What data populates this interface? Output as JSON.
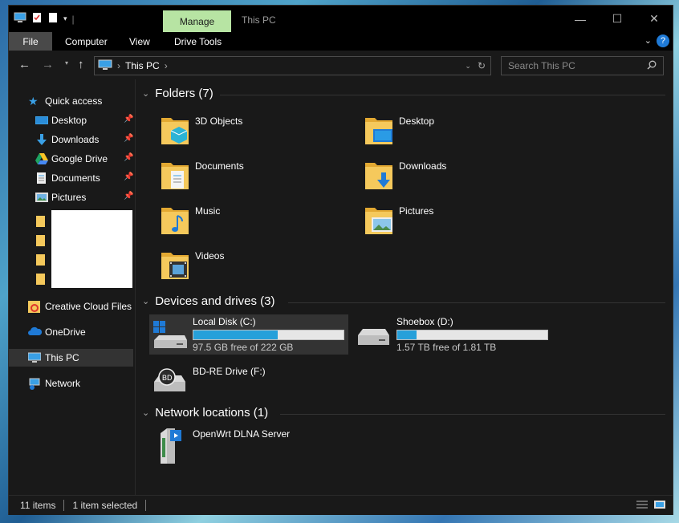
{
  "titlebar": {
    "manage_tab": "Manage",
    "window_title": "This PC",
    "minimize": "—",
    "maximize": "☐",
    "close": "✕"
  },
  "ribbon": {
    "tabs": [
      "File",
      "Computer",
      "View",
      "Drive Tools"
    ],
    "help": "?"
  },
  "address": {
    "path": [
      "This PC"
    ],
    "search_placeholder": "Search This PC"
  },
  "nav": {
    "quick_access": "Quick access",
    "items": [
      {
        "label": "Desktop",
        "pinned": true
      },
      {
        "label": "Downloads",
        "pinned": true
      },
      {
        "label": "Google Drive",
        "pinned": true
      },
      {
        "label": "Documents",
        "pinned": true
      },
      {
        "label": "Pictures",
        "pinned": true
      }
    ],
    "creative_cloud": "Creative Cloud Files",
    "onedrive": "OneDrive",
    "this_pc": "This PC",
    "network": "Network"
  },
  "content": {
    "folders_header": "Folders (7)",
    "folders": [
      "3D Objects",
      "Desktop",
      "Documents",
      "Downloads",
      "Music",
      "Pictures",
      "Videos"
    ],
    "devices_header": "Devices and drives (3)",
    "drives": [
      {
        "name": "Local Disk (C:)",
        "free": "97.5 GB free of 222 GB",
        "used_fraction": 0.56
      },
      {
        "name": "Shoebox (D:)",
        "free": "1.57 TB free of 1.81 TB",
        "used_fraction": 0.13
      },
      {
        "name": "BD-RE Drive (F:)"
      }
    ],
    "network_header": "Network locations (1)",
    "network_items": [
      "OpenWrt DLNA Server"
    ]
  },
  "status": {
    "item_count": "11 items",
    "selected": "1 item selected"
  },
  "colors": {
    "background": "#191919",
    "accent": "#26a0da",
    "manage_tab": "#b7e4a3",
    "folder": "#f5c95c"
  }
}
